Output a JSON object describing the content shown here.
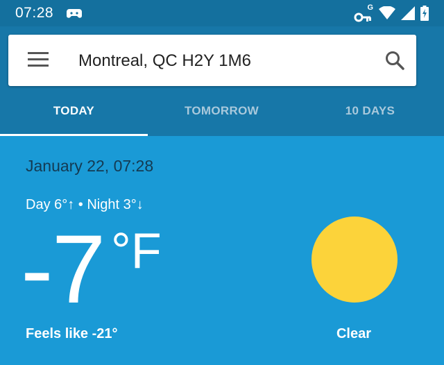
{
  "status_bar": {
    "time": "07:28",
    "icons": [
      "game-controller-icon",
      "vpn-key-icon",
      "wifi-icon",
      "cell-signal-icon",
      "battery-charging-icon"
    ],
    "vpn_badge": "G"
  },
  "header": {
    "location": "Montreal, QC H2Y 1M6",
    "menu_icon": "menu-icon",
    "search_icon": "search-icon"
  },
  "tabs": [
    {
      "label": "TODAY",
      "active": true
    },
    {
      "label": "TOMORROW",
      "active": false
    },
    {
      "label": "10 DAYS",
      "active": false
    }
  ],
  "weather": {
    "date": "January 22, 07:28",
    "day_night": "Day 6°↑ • Night 3°↓",
    "temperature": "-7",
    "unit": "°F",
    "feels_like": "Feels like -21°",
    "condition": "Clear",
    "condition_icon": "sun-icon"
  },
  "colors": {
    "status_bar": "#14709e",
    "app_bar": "#1777a8",
    "background": "#1a9ad6",
    "sun": "#fcd33a",
    "date_text": "#143a52"
  }
}
